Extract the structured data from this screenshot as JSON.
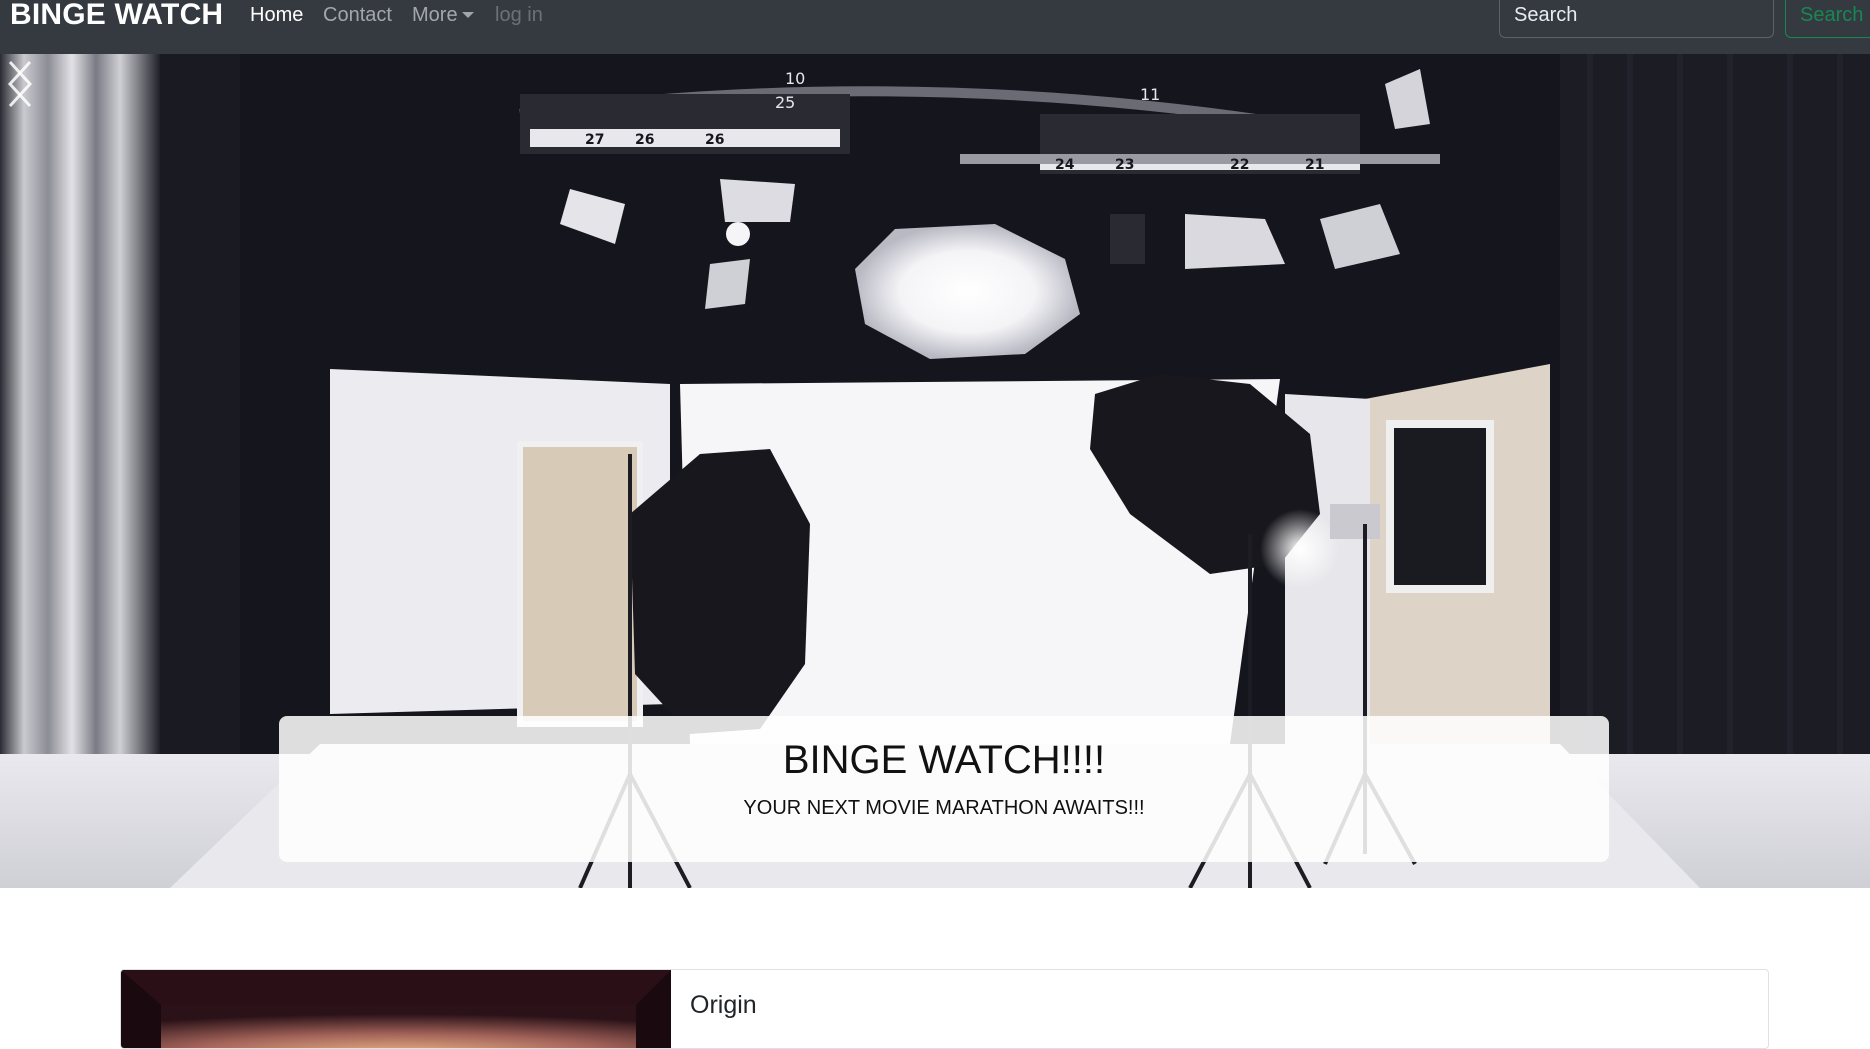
{
  "navbar": {
    "brand": "BINGE WATCH",
    "links": [
      {
        "label": "Home"
      },
      {
        "label": "Contact"
      },
      {
        "label": "More"
      },
      {
        "label": "log in"
      }
    ],
    "search": {
      "placeholder": "Search",
      "button_label": "Search"
    },
    "colors": {
      "background": "#343a40",
      "search_accent": "#198754"
    }
  },
  "carousel": {
    "caption_title": "BINGE WATCH!!!!",
    "caption_text": "YOUR NEXT MOVIE MARATHON AWAITS!!!",
    "prev_icon": "chevron-left-icon",
    "next_icon": "chevron-right-icon",
    "rail_numbers": [
      "27",
      "26",
      "26",
      "10",
      "25",
      "11",
      "24",
      "23",
      "22",
      "21"
    ]
  },
  "cards": [
    {
      "title": "Origin"
    }
  ]
}
